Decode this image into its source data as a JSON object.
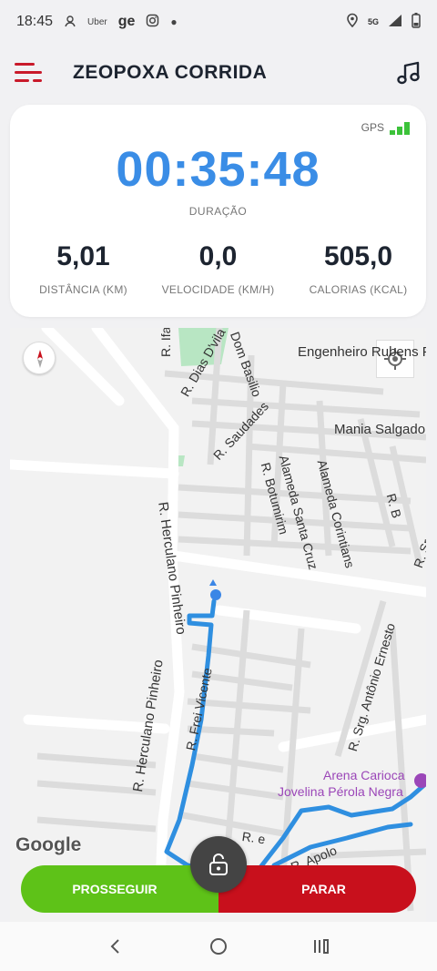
{
  "status_bar": {
    "time": "18:45",
    "notification_icons": [
      "Uber",
      "ge"
    ],
    "network": "5G"
  },
  "app_bar": {
    "title": "ZEOPOXA CORRIDA",
    "menu_icon": "hamburger-menu-icon",
    "music_icon": "music-note-icon",
    "accent_color": "#c91a2a"
  },
  "stats": {
    "gps_label": "GPS",
    "gps_signal_bars": 3,
    "duration_value": "00:35:48",
    "duration_label": "DURAÇÃO",
    "distance_value": "5,01",
    "distance_label": "DISTÂNCIA (KM)",
    "speed_value": "0,0",
    "speed_label": "VELOCIDADE (KM/H)",
    "calories_value": "505,0",
    "calories_label": "CALORIAS (KCAL)",
    "timer_color": "#3a8de6"
  },
  "map": {
    "streets": [
      "R. Ifa",
      "R. Dias D'vila",
      "Dom Basilio",
      "R. Saudades",
      "R. Botumirim",
      "Alameda Santa Cruz",
      "Alameda Corintians",
      "R. B",
      "R. Sro",
      "R. Herculano Pinheiro",
      "R. Frei Vicente",
      "R. Srg. Antônio Ernesto",
      "R. Apolo",
      "R. e"
    ],
    "places": [
      "Engenheiro Rubens P",
      "Mania Salgado"
    ],
    "poi": [
      "Arena Carioca",
      "Jovelina Pérola Negra"
    ],
    "google_logo": "Google",
    "route_color": "#2f8fe0"
  },
  "actions": {
    "continue_label": "PROSSEGUIR",
    "stop_label": "PARAR",
    "lock_icon": "unlock-icon",
    "continue_color": "#5ec218",
    "stop_color": "#c8101c"
  },
  "nav": {
    "back_icon": "back-chevron-icon",
    "home_icon": "home-circle-icon",
    "recents_icon": "recents-icon"
  }
}
